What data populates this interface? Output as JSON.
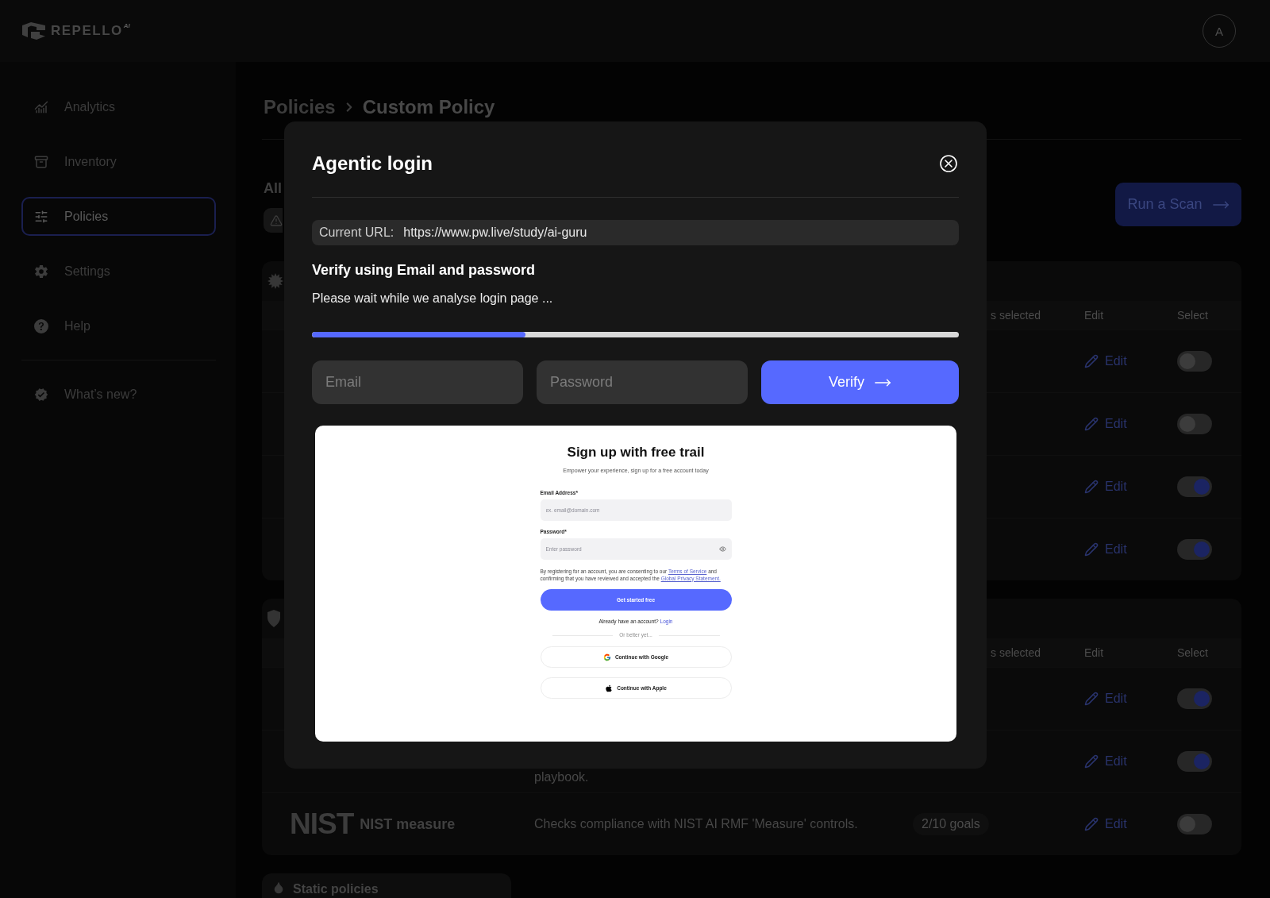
{
  "header": {
    "logo": {
      "name": "REPELLO",
      "badge": "AI"
    },
    "avatar": "A"
  },
  "sidebar": {
    "items": [
      {
        "label": "Analytics",
        "selected": false
      },
      {
        "label": "Inventory",
        "selected": false
      },
      {
        "label": "Policies",
        "selected": true
      },
      {
        "label": "Settings",
        "selected": false
      },
      {
        "label": "Help",
        "selected": false
      }
    ],
    "footer_items": [
      {
        "label": "What’s new?",
        "selected": false
      }
    ]
  },
  "breadcrumb": [
    "Policies",
    "Custom Policy"
  ],
  "filters": {
    "label": "All"
  },
  "run_scan_button": "Run a Scan",
  "policy_groups": [
    {
      "columns": [
        "s selected",
        "Edit",
        "Select"
      ],
      "rows": [
        {
          "edit": "Edit",
          "on": false
        },
        {
          "edit": "Edit",
          "on": false
        },
        {
          "edit": "Edit",
          "on": true
        },
        {
          "edit": "Edit",
          "on": true
        }
      ]
    },
    {
      "columns": [
        "s selected",
        "Edit",
        "Select"
      ],
      "rows": [
        {
          "edit": "Edit",
          "on": true
        },
        {
          "description": "playbook.",
          "edit": "Edit",
          "on": true
        },
        {
          "logo": "NIST",
          "name": "NIST measure",
          "description": "Checks compliance with NIST AI RMF 'Measure' controls.",
          "goals": "2/10 goals",
          "edit": "Edit",
          "on": false
        }
      ]
    }
  ],
  "static_policies": {
    "title": "Static policies"
  },
  "dialog": {
    "title": "Agentic login",
    "current_url": {
      "label": "Current URL:",
      "value": "https://www.pw.live/study/ai-guru"
    },
    "heading": "Verify using Email and password",
    "status": "Please wait while we analyse login page ...",
    "progress": {
      "level": 0.33
    },
    "email_field": {
      "placeholder": "Email"
    },
    "password_field": {
      "placeholder": "Password"
    },
    "verify_button": "Verify",
    "preview": {
      "title": "Sign up with free trail",
      "subtitle": "Empower your experience, sign up for a free account today",
      "fields": [
        {
          "kind": "text",
          "label": "Email Address*",
          "placeholder": "ex. email@domain.com"
        },
        {
          "kind": "password",
          "label": "Password*",
          "placeholder": "Enter password"
        }
      ],
      "consent": [
        {
          "kind": "text",
          "text": "By registering for an account, you are consenting to our"
        },
        {
          "kind": "link",
          "text": "Terms of Service"
        },
        {
          "kind": "text",
          "text": "and confirming that you have reviewed and accepted the"
        },
        {
          "kind": "link",
          "text": "Global Privacy Statement."
        }
      ],
      "submit_button": "Get started free",
      "login_prompt": {
        "text": "Already have an account?",
        "link": "Login"
      },
      "separator": "Or better yet...",
      "social_buttons": [
        "Continue with Google",
        "Continue with Apple"
      ]
    }
  }
}
